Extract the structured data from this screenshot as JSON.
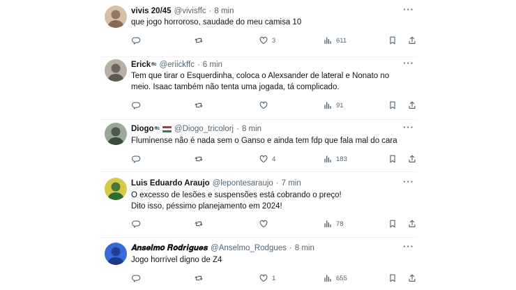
{
  "tweets": [
    {
      "name": "vivis 20/45",
      "name_badge": "",
      "has_flag": false,
      "handle": "@vivisffc",
      "time": "8 min",
      "text": "que jogo horroroso, saudade do meu camisa 10",
      "replies": "",
      "retweets": "",
      "likes": "3",
      "views": "611",
      "avatar_colors": [
        "#8a6a55",
        "#d8c0a8"
      ]
    },
    {
      "name": "Erick",
      "name_badge": "ffc",
      "has_flag": false,
      "handle": "@eriickffc",
      "time": "6 min",
      "text": "Tem que tirar o Esquerdinha, coloca o Alexsander de lateral e Nonato no meio. Isaac também não tenta uma jogada, tá complicado.",
      "replies": "",
      "retweets": "",
      "likes": "",
      "views": "91",
      "avatar_colors": [
        "#5a5a52",
        "#b8b0a4"
      ]
    },
    {
      "name": "Diogo",
      "name_badge": "ffc",
      "has_flag": true,
      "handle": "@Diogo_tricolorj",
      "time": "8 min",
      "text": "Fluminense não é nada sem o Ganso e ainda tem fdp que fala mal do cara",
      "replies": "",
      "retweets": "",
      "likes": "4",
      "views": "183",
      "avatar_colors": [
        "#3a4a3c",
        "#9aa89a"
      ]
    },
    {
      "name": "Luis Eduardo Araujo",
      "name_badge": "",
      "has_flag": false,
      "handle": "@lepontesaraujo",
      "time": "7 min",
      "text": "O excesso de lesões e suspensões está cobrando o preço!\nDito isso, péssimo planejamento em 2024!",
      "replies": "",
      "retweets": "",
      "likes": "",
      "views": "78",
      "avatar_colors": [
        "#2f6b2f",
        "#d8c84a"
      ]
    },
    {
      "name": "𝑨𝒏𝒔𝒆𝒍𝒎𝒐 𝑹𝒐𝒅𝒓𝒊𝒈𝒖𝒆𝒔",
      "name_badge": "",
      "has_flag": false,
      "handle": "@Anselmo_Rodgues",
      "time": "8 min",
      "text": "Jogo horrível digno de Z4",
      "replies": "",
      "retweets": "",
      "likes": "1",
      "views": "655",
      "avatar_colors": [
        "#1a3a8a",
        "#3a6ad8"
      ]
    }
  ],
  "icons": {
    "reply": "reply-icon",
    "retweet": "retweet-icon",
    "like": "heart-icon",
    "views": "views-icon",
    "bookmark": "bookmark-icon",
    "share": "share-icon",
    "more": "more-icon"
  },
  "more_label": "···",
  "colors": {
    "text": "#0f1419",
    "muted": "#536471",
    "divider": "#eff3f4"
  }
}
